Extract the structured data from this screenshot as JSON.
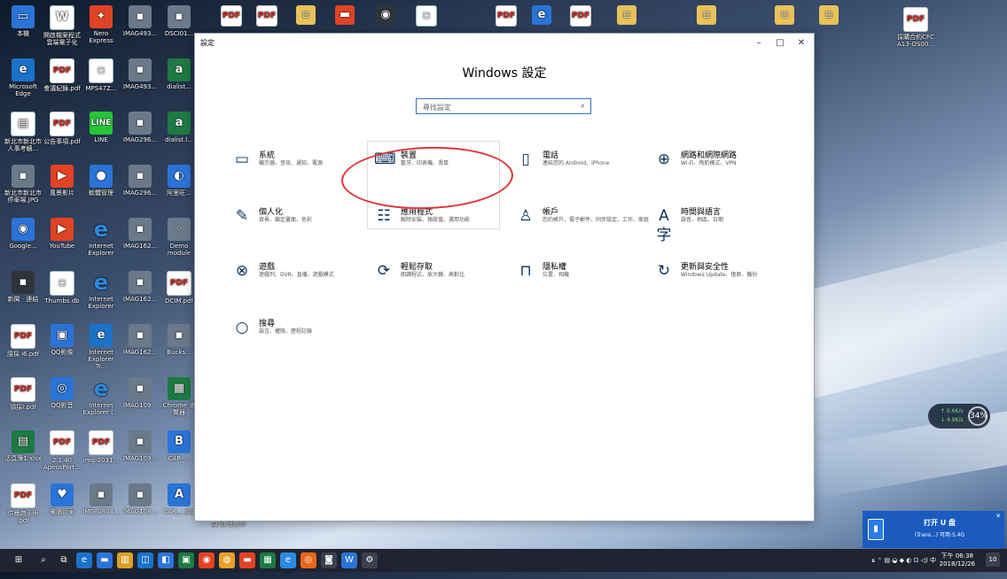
{
  "desktop": {
    "icons": [
      {
        "label": "本機",
        "glyph": "▭",
        "cls": "g-blue"
      },
      {
        "label": "開啟檔案程式 雲端電子化",
        "glyph": "W",
        "cls": "g-doc"
      },
      {
        "label": "Nero Express",
        "glyph": "✦",
        "cls": "g-red"
      },
      {
        "label": "IMAG493...",
        "glyph": "▪",
        "cls": "g-img"
      },
      {
        "label": "DSCI01...",
        "glyph": "▪",
        "cls": "g-img"
      },
      {
        "label": "Microsoft Edge",
        "glyph": "e",
        "cls": "g-edge"
      },
      {
        "label": "會議紀錄.pdf",
        "glyph": "PDF",
        "cls": "g-pdf"
      },
      {
        "label": "MPS47Z...",
        "glyph": "▫",
        "cls": "g-doc"
      },
      {
        "label": "IMAG493...",
        "glyph": "▪",
        "cls": "g-img"
      },
      {
        "label": "dialist...",
        "glyph": "a",
        "cls": "g-xls"
      },
      {
        "label": "新北市新北市 人事考績...",
        "glyph": "▤",
        "cls": "g-doc"
      },
      {
        "label": "公告事項.pdf",
        "glyph": "PDF",
        "cls": "g-pdf"
      },
      {
        "label": "LINE",
        "glyph": "LINE",
        "cls": "g-line"
      },
      {
        "label": "IMAG296...",
        "glyph": "▪",
        "cls": "g-img"
      },
      {
        "label": "dialist.l...",
        "glyph": "a",
        "cls": "g-xls"
      },
      {
        "label": "新北市新北市 停車場.JPG",
        "glyph": "▪",
        "cls": "g-img"
      },
      {
        "label": "風景影片",
        "glyph": "▶",
        "cls": "g-red"
      },
      {
        "label": "軟體管理",
        "glyph": "●",
        "cls": "g-blue"
      },
      {
        "label": "IMAG296...",
        "glyph": "▪",
        "cls": "g-img"
      },
      {
        "label": "阿里旺...",
        "glyph": "◐",
        "cls": "g-blue"
      },
      {
        "label": "Google...",
        "glyph": "◉",
        "cls": "g-blue"
      },
      {
        "label": "YouTube",
        "glyph": "▶",
        "cls": "g-red"
      },
      {
        "label": "Internet Explorer",
        "glyph": "e",
        "cls": "g-ie"
      },
      {
        "label": "IMAG162...",
        "glyph": "▪",
        "cls": "g-img"
      },
      {
        "label": "Demo module",
        "glyph": "◦",
        "cls": "g-img"
      },
      {
        "label": "新聞 · 連結",
        "glyph": "▪",
        "cls": "g-dark"
      },
      {
        "label": "Thumbs.db",
        "glyph": "▫",
        "cls": "g-doc"
      },
      {
        "label": "Internet Explorer",
        "glyph": "e",
        "cls": "g-ie"
      },
      {
        "label": "IMAG162...",
        "glyph": "▪",
        "cls": "g-img"
      },
      {
        "label": "DCIM.pdf",
        "glyph": "PDF",
        "cls": "g-pdf"
      },
      {
        "label": "請採 i6.pdf",
        "glyph": "PDF",
        "cls": "g-pdf"
      },
      {
        "label": "QQ影像",
        "glyph": "▣",
        "cls": "g-blue"
      },
      {
        "label": "Internet Explorer Tr...",
        "glyph": "e",
        "cls": "g-edge"
      },
      {
        "label": "IMAG162...",
        "glyph": "▪",
        "cls": "g-img"
      },
      {
        "label": "Bucks...",
        "glyph": "▪",
        "cls": "g-img"
      },
      {
        "label": "請採i.pdf",
        "glyph": "PDF",
        "cls": "g-pdf"
      },
      {
        "label": "QQ影音",
        "glyph": "◎",
        "cls": "g-blue"
      },
      {
        "label": "Internet Explorer (...",
        "glyph": "e",
        "cls": "g-ie"
      },
      {
        "label": "IMAG109...",
        "glyph": "▪",
        "cls": "g-img"
      },
      {
        "label": "Chrome 瀏覽器",
        "glyph": "▦",
        "cls": "g-xls"
      },
      {
        "label": "活頁簿1.xlsx",
        "glyph": "▤",
        "cls": "g-xls"
      },
      {
        "label": "2.1.40 ApeosPort...",
        "glyph": "PDF",
        "cls": "g-pdf"
      },
      {
        "label": "img-2031...",
        "glyph": "PDF",
        "cls": "g-pdf"
      },
      {
        "label": "IMAG109...",
        "glyph": "▪",
        "cls": "g-img"
      },
      {
        "label": "CAR_...",
        "glyph": "B",
        "cls": "g-blue"
      },
      {
        "label": "供應商手冊 .pdf",
        "glyph": "PDF",
        "cls": "g-pdf"
      },
      {
        "label": "電腦管家",
        "glyph": "♥",
        "cls": "g-blue"
      },
      {
        "label": "IMG_0804...",
        "glyph": "▪",
        "cls": "g-img"
      },
      {
        "label": "IMAG108...",
        "glyph": "▪",
        "cls": "g-img"
      },
      {
        "label": "CAR_...jpg",
        "glyph": "A",
        "cls": "g-blue"
      }
    ],
    "top_icons": [
      {
        "glyph": "PDF",
        "cls": "g-pdf"
      },
      {
        "glyph": "PDF",
        "cls": "g-pdf"
      },
      {
        "glyph": "▫",
        "cls": "g-folder"
      },
      {
        "glyph": "▬",
        "cls": "g-red"
      },
      {
        "glyph": "◉",
        "cls": "g-dark"
      },
      {
        "glyph": "▫",
        "cls": "g-doc"
      },
      {
        "glyph": "PDF",
        "cls": "g-pdf"
      },
      {
        "glyph": "e",
        "cls": "g-blue"
      },
      {
        "glyph": "PDF",
        "cls": "g-pdf"
      },
      {
        "glyph": "▫",
        "cls": "g-folder"
      },
      {
        "glyph": "▫",
        "cls": "g-folder"
      },
      {
        "glyph": "▫",
        "cls": "g-folder"
      },
      {
        "glyph": "▫",
        "cls": "g-folder"
      }
    ],
    "right_icon": {
      "label": "採購合約CFC A13-OS00...",
      "glyph": "PDF"
    },
    "bottom_file_label": "擷 取 圖.pdf"
  },
  "window": {
    "title": "設定",
    "minimize": "–",
    "maximize": "□",
    "close": "✕",
    "heading": "Windows 設定",
    "search_placeholder": "尋找設定",
    "items": [
      {
        "icon": "▭",
        "label": "系統",
        "sub": "顯示器、音效、通知、電源",
        "name": "system"
      },
      {
        "icon": "⌨",
        "label": "裝置",
        "sub": "藍牙、印表機、滑鼠",
        "name": "devices"
      },
      {
        "icon": "▯",
        "label": "電話",
        "sub": "連結您的 Android、iPhone",
        "name": "phone"
      },
      {
        "icon": "⊕",
        "label": "網路和網際網路",
        "sub": "Wi-Fi、飛航模式、VPN",
        "name": "network"
      },
      {
        "icon": "✎",
        "label": "個人化",
        "sub": "背景、鎖定畫面、色彩",
        "name": "personalization"
      },
      {
        "icon": "☷",
        "label": "應用程式",
        "sub": "解除安裝、預設值、選用功能",
        "name": "apps"
      },
      {
        "icon": "♙",
        "label": "帳戶",
        "sub": "您的帳戶、電子郵件、同步設定、工作、家庭",
        "name": "accounts"
      },
      {
        "icon": "A字",
        "label": "時間與語言",
        "sub": "語音、地區、日期",
        "name": "time-language"
      },
      {
        "icon": "⊗",
        "label": "遊戲",
        "sub": "遊戲列、DVR、直播、遊戲模式",
        "name": "gaming"
      },
      {
        "icon": "⟳",
        "label": "輕鬆存取",
        "sub": "朗讀程式、放大鏡、高對比",
        "name": "ease-of-access"
      },
      {
        "icon": "⊓",
        "label": "隱私權",
        "sub": "位置、相機",
        "name": "privacy"
      },
      {
        "icon": "↻",
        "label": "更新與安全性",
        "sub": "Windows Update、復原、備份",
        "name": "update-security"
      },
      {
        "icon": "○",
        "label": "搜尋",
        "sub": "語言、權限、歷程記錄",
        "name": "search"
      }
    ]
  },
  "netmeter": {
    "up": "↑ 0.6K/s",
    "down": "↓ 4.9K/s",
    "pct": "34%"
  },
  "usb_popup": {
    "title": "打开 U 盘",
    "sub": "(Trans...) 可用:5.4G",
    "close": "✕"
  },
  "taskbar": {
    "start": "⊞",
    "apps": [
      "⌕",
      "⧉",
      "e",
      "▬",
      "▥",
      "◫",
      "◧",
      "▣",
      "◉",
      "◍",
      "▬",
      "▦",
      "e",
      "◎",
      "◙",
      "W",
      "⚙"
    ],
    "tray": "ꭱ ⌃ ▤ ◒ ◆ ◐ ⊡ ◁) 中",
    "time": "下午 06:38",
    "date": "2018/12/26",
    "notif_count": "10"
  }
}
